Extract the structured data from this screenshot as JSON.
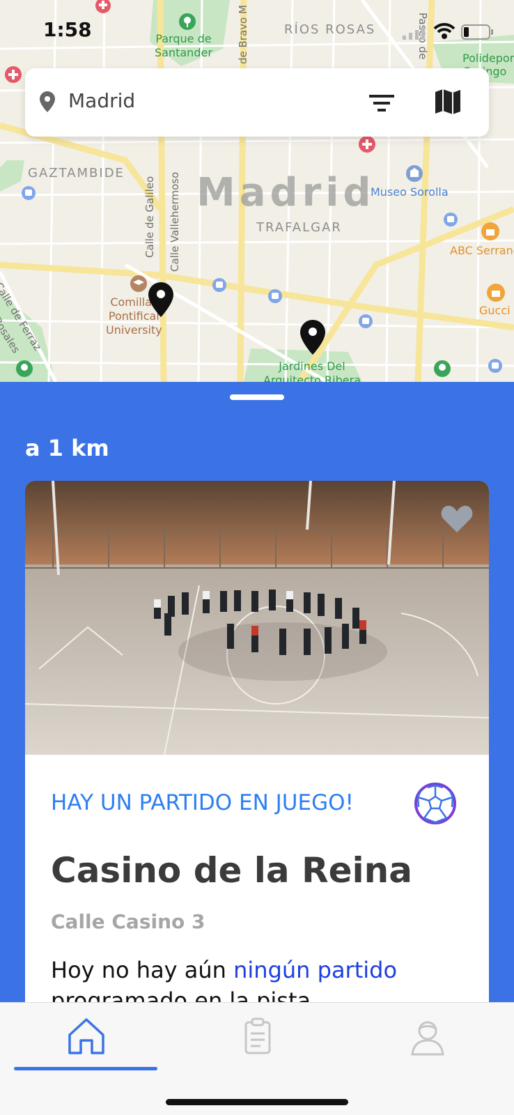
{
  "status_bar": {
    "time": "1:58"
  },
  "map": {
    "city_label": "Madrid",
    "districts": [
      "RÍOS ROSAS",
      "GAZTAMBIDE",
      "TRAFALGAR"
    ],
    "parks": [
      "Parque de\nSantander",
      "Jardines Del\nArquitecto Ribera"
    ],
    "pois": [
      "Museo Sorolla",
      "ABC Serrano",
      "Gucci",
      "Polideportivo\nGaringo"
    ],
    "university": "Comillas\nPontifical\nUniversity",
    "streets": [
      "Calle de Galileo",
      "Calle Vallehermoso",
      "Calle de Ferraz",
      "Rosales",
      "de Bravo M",
      "Paseo de"
    ]
  },
  "search": {
    "value": "Madrid",
    "pin_icon": "location-pin-icon",
    "filter_icon": "filter-icon",
    "map_icon": "map-icon"
  },
  "sheet": {
    "distance": "a 1 km",
    "card": {
      "status": "HAY UN PARTIDO EN JUEGO!",
      "name": "Casino de la Reina",
      "address": "Calle Casino 3",
      "desc_prefix": "Hoy no hay aún ",
      "desc_highlight": "ningún partido",
      "desc_suffix": " programado en la pista"
    }
  },
  "tabs": [
    {
      "name": "home",
      "icon": "home-icon",
      "active": true
    },
    {
      "name": "list",
      "icon": "clipboard-icon",
      "active": false
    },
    {
      "name": "profile",
      "icon": "user-icon",
      "active": false
    }
  ],
  "colors": {
    "accent": "#3b73e6",
    "status_blue": "#2d7ff0",
    "link": "#1e3fe0"
  }
}
